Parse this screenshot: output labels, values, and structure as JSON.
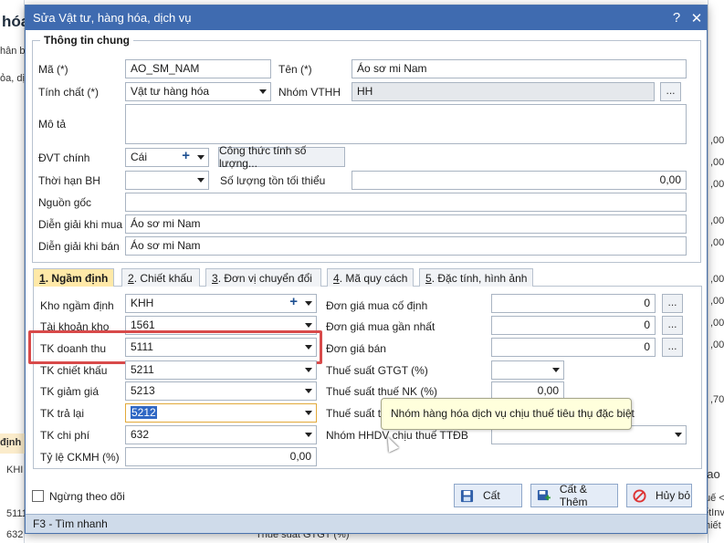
{
  "background": {
    "left_title": "hóa",
    "left_texts": [
      "hân b",
      "ỏa, dị",
      "định",
      "KHI",
      "5111",
      "632"
    ],
    "right_values": [
      ",00)",
      ",00)",
      ",00)",
      ",00)",
      ",00)",
      ",00)",
      ",00)",
      ",00)",
      ",00)",
      ",70"
    ],
    "bottom_text": "Thuế suất GTGT (%)",
    "right_snippets": [
      "bao",
      "uế <",
      "ếtInv",
      "hiết"
    ]
  },
  "dialog": {
    "title": "Sửa Vật tư, hàng hóa, dịch vụ",
    "help": "?",
    "close": "✕",
    "group_title": "Thông tin chung",
    "ma_label": "Mã (*)",
    "ma_value": "AO_SM_NAM",
    "ten_label": "Tên (*)",
    "ten_value": "Áo sơ mi Nam",
    "tinhchat_label": "Tính chất (*)",
    "tinhchat_value": "Vật tư hàng hóa",
    "nhom_label": "Nhóm VTHH",
    "nhom_value": "HH",
    "dots": "...",
    "mota_label": "Mô tả",
    "mota_value": "",
    "dvt_label": "ĐVT chính",
    "dvt_value": "Cái",
    "plus": "+",
    "congthuc_btn": "Công thức tính số lượng...",
    "thoihan_label": "Thời hạn BH",
    "soluong_label": "Số lượng tồn tối thiểu",
    "soluong_value": "0,00",
    "nguongoc_label": "Nguồn gốc",
    "diengiai_mua_label": "Diễn giải khi mua",
    "diengiai_mua_value": "Áo sơ mi Nam",
    "diengiai_ban_label": "Diễn giải khi bán",
    "diengiai_ban_value": "Áo sơ mi Nam"
  },
  "tabs": [
    {
      "num": "1",
      "label": ". Ngầm định"
    },
    {
      "num": "2",
      "label": ". Chiết khấu"
    },
    {
      "num": "3",
      "label": ". Đơn vị chuyển đổi"
    },
    {
      "num": "4",
      "label": ". Mã quy cách"
    },
    {
      "num": "5",
      "label": ". Đặc tính, hình ảnh"
    }
  ],
  "defaults": {
    "kho_label": "Kho ngầm định",
    "kho_value": "KHH",
    "tkkho_label": "Tài khoản kho",
    "tkkho_value": "1561",
    "tkdt_label": "TK doanh thu",
    "tkdt_value": "5111",
    "tkck_label": "TK chiết khấu",
    "tkck_value": "5211",
    "tkgg_label": "TK giảm giá",
    "tkgg_value": "5213",
    "tktl_label": "TK trả lại",
    "tktl_value": "5212",
    "tkcp_label": "TK chi phí",
    "tkcp_value": "632",
    "tyle_label": "Tỷ lệ CKMH (%)",
    "tyle_value": "0,00",
    "dgcd_label": "Đơn giá mua cố định",
    "dgcd_value": "0",
    "dggn_label": "Đơn giá mua gần nhất",
    "dggn_value": "0",
    "dgb_label": "Đơn giá bán",
    "dgb_value": "0",
    "gtgt_label": "Thuế suất GTGT (%)",
    "nk_label": "Thuế suất thuế NK (%)",
    "nk_value": "0,00",
    "th_label": "Thuế suất th",
    "hhdv_label": "Nhóm HHDV chịu thuế TTĐB"
  },
  "tooltip": "Nhóm hàng hóa dịch vụ chịu thuế tiêu thụ đặc biệt",
  "footer": {
    "ngung": "Ngừng theo dõi",
    "cat": "Cất",
    "cat_them": "Cất & Thêm",
    "huy": "Hủy bỏ",
    "status": "F3 - Tìm nhanh"
  },
  "colors": {
    "titlebar": "#3f6bb0",
    "tab_active": "#ffe9a8",
    "highlight": "#d84a4a",
    "selection": "#2f67c4"
  }
}
